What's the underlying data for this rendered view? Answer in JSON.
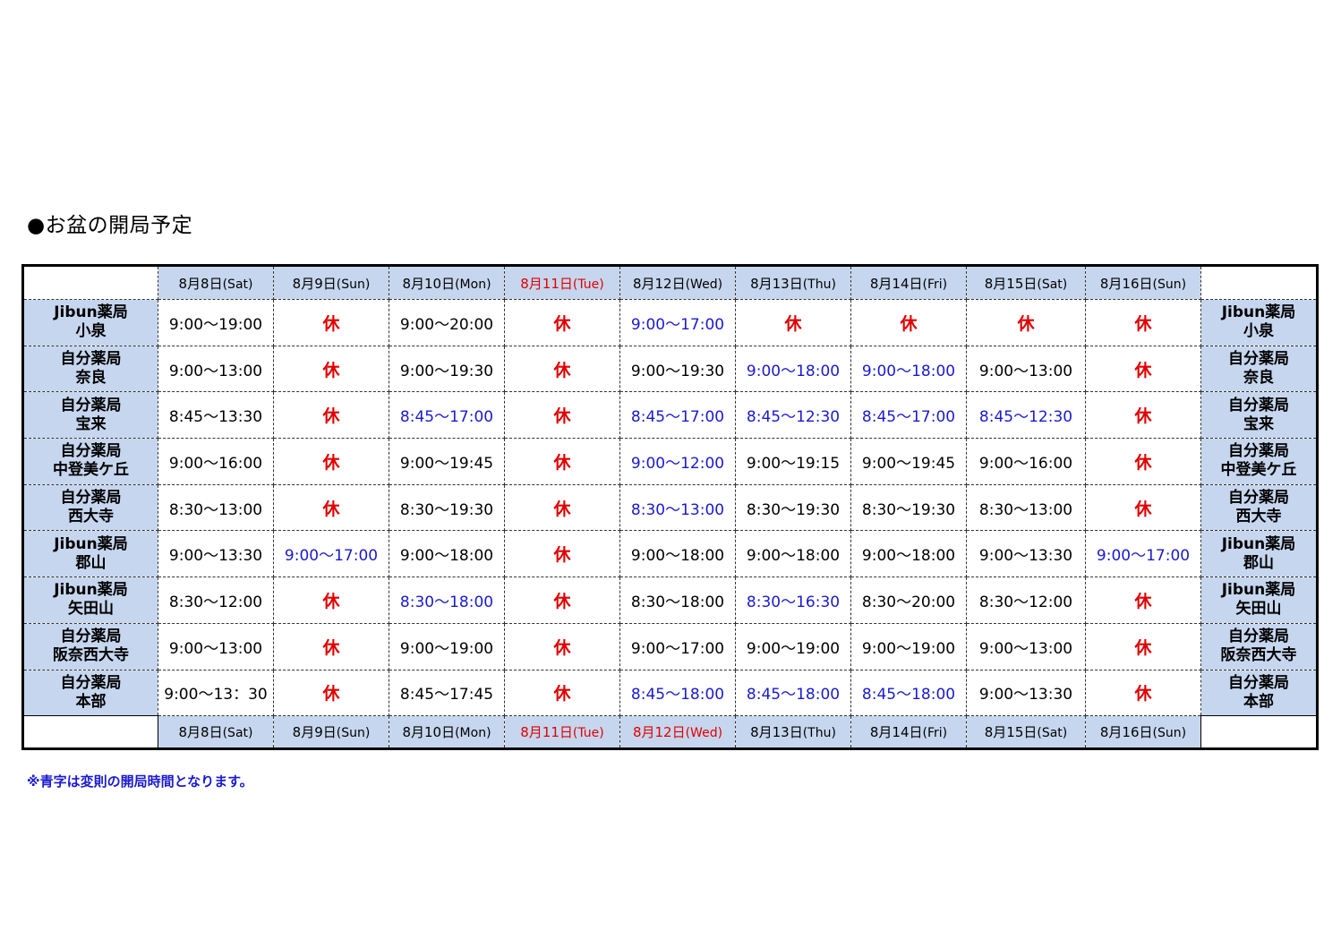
{
  "title": "●お盆の開局予定",
  "note": "※青字は変則の開局時間となります。",
  "colors": {
    "header_bg": "#c6d6ee",
    "holiday_red": "#e00000",
    "irregular_blue": "#1a1ad0"
  },
  "header_dates": [
    {
      "date": "8月8日",
      "dow": "(Sat)",
      "red": false
    },
    {
      "date": "8月9日",
      "dow": "(Sun)",
      "red": false
    },
    {
      "date": "8月10日",
      "dow": "(Mon)",
      "red": false
    },
    {
      "date": "8月11日",
      "dow": "(Tue)",
      "red": true
    },
    {
      "date": "8月12日",
      "dow": "(Wed)",
      "red": false
    },
    {
      "date": "8月13日",
      "dow": "(Thu)",
      "red": false
    },
    {
      "date": "8月14日",
      "dow": "(Fri)",
      "red": false
    },
    {
      "date": "8月15日",
      "dow": "(Sat)",
      "red": false
    },
    {
      "date": "8月16日",
      "dow": "(Sun)",
      "red": false
    }
  ],
  "footer_dates": [
    {
      "date": "8月8日",
      "dow": "(Sat)",
      "red": false
    },
    {
      "date": "8月9日",
      "dow": "(Sun)",
      "red": false
    },
    {
      "date": "8月10日",
      "dow": "(Mon)",
      "red": false
    },
    {
      "date": "8月11日",
      "dow": "(Tue)",
      "red": true
    },
    {
      "date": "8月12日",
      "dow": "(Wed)",
      "red": true
    },
    {
      "date": "8月13日",
      "dow": "(Thu)",
      "red": false
    },
    {
      "date": "8月14日",
      "dow": "(Fri)",
      "red": false
    },
    {
      "date": "8月15日",
      "dow": "(Sat)",
      "red": false
    },
    {
      "date": "8月16日",
      "dow": "(Sun)",
      "red": false
    }
  ],
  "pharmacies": [
    {
      "brand": "Jibun薬局",
      "branch": "小泉",
      "hours": [
        {
          "text": "9:00〜19:00",
          "style": "normal"
        },
        {
          "text": "休",
          "style": "closed"
        },
        {
          "text": "9:00〜20:00",
          "style": "normal"
        },
        {
          "text": "休",
          "style": "closed"
        },
        {
          "text": "9:00〜17:00",
          "style": "blue"
        },
        {
          "text": "休",
          "style": "closed"
        },
        {
          "text": "休",
          "style": "closed"
        },
        {
          "text": "休",
          "style": "closed"
        },
        {
          "text": "休",
          "style": "closed"
        }
      ]
    },
    {
      "brand": "自分薬局",
      "branch": "奈良",
      "hours": [
        {
          "text": "9:00〜13:00",
          "style": "normal"
        },
        {
          "text": "休",
          "style": "closed"
        },
        {
          "text": "9:00〜19:30",
          "style": "normal"
        },
        {
          "text": "休",
          "style": "closed"
        },
        {
          "text": "9:00〜19:30",
          "style": "normal"
        },
        {
          "text": "9:00〜18:00",
          "style": "blue"
        },
        {
          "text": "9:00〜18:00",
          "style": "blue"
        },
        {
          "text": "9:00〜13:00",
          "style": "normal"
        },
        {
          "text": "休",
          "style": "closed"
        }
      ]
    },
    {
      "brand": "自分薬局",
      "branch": "宝来",
      "hours": [
        {
          "text": "8:45〜13:30",
          "style": "normal"
        },
        {
          "text": "休",
          "style": "closed"
        },
        {
          "text": "8:45〜17:00",
          "style": "blue"
        },
        {
          "text": "休",
          "style": "closed"
        },
        {
          "text": "8:45〜17:00",
          "style": "blue"
        },
        {
          "text": "8:45〜12:30",
          "style": "blue"
        },
        {
          "text": "8:45〜17:00",
          "style": "blue"
        },
        {
          "text": "8:45〜12:30",
          "style": "blue"
        },
        {
          "text": "休",
          "style": "closed"
        }
      ]
    },
    {
      "brand": "自分薬局",
      "branch": "中登美ケ丘",
      "hours": [
        {
          "text": "9:00〜16:00",
          "style": "normal"
        },
        {
          "text": "休",
          "style": "closed"
        },
        {
          "text": "9:00〜19:45",
          "style": "normal"
        },
        {
          "text": "休",
          "style": "closed"
        },
        {
          "text": "9:00〜12:00",
          "style": "blue"
        },
        {
          "text": "9:00〜19:15",
          "style": "normal"
        },
        {
          "text": "9:00〜19:45",
          "style": "normal"
        },
        {
          "text": "9:00〜16:00",
          "style": "normal"
        },
        {
          "text": "休",
          "style": "closed"
        }
      ]
    },
    {
      "brand": "自分薬局",
      "branch": "西大寺",
      "hours": [
        {
          "text": "8:30〜13:00",
          "style": "normal"
        },
        {
          "text": "休",
          "style": "closed"
        },
        {
          "text": "8:30〜19:30",
          "style": "normal"
        },
        {
          "text": "休",
          "style": "closed"
        },
        {
          "text": "8:30〜13:00",
          "style": "blue"
        },
        {
          "text": "8:30〜19:30",
          "style": "normal"
        },
        {
          "text": "8:30〜19:30",
          "style": "normal"
        },
        {
          "text": "8:30〜13:00",
          "style": "normal"
        },
        {
          "text": "休",
          "style": "closed"
        }
      ]
    },
    {
      "brand": "Jibun薬局",
      "branch": "郡山",
      "hours": [
        {
          "text": "9:00〜13:30",
          "style": "normal"
        },
        {
          "text": "9:00〜17:00",
          "style": "blue"
        },
        {
          "text": "9:00〜18:00",
          "style": "normal"
        },
        {
          "text": "休",
          "style": "closed"
        },
        {
          "text": "9:00〜18:00",
          "style": "normal"
        },
        {
          "text": "9:00〜18:00",
          "style": "normal"
        },
        {
          "text": "9:00〜18:00",
          "style": "normal"
        },
        {
          "text": "9:00〜13:30",
          "style": "normal"
        },
        {
          "text": "9:00〜17:00",
          "style": "blue"
        }
      ]
    },
    {
      "brand": "Jibun薬局",
      "branch": "矢田山",
      "hours": [
        {
          "text": "8:30〜12:00",
          "style": "normal"
        },
        {
          "text": "休",
          "style": "closed"
        },
        {
          "text": "8:30〜18:00",
          "style": "blue"
        },
        {
          "text": "休",
          "style": "closed"
        },
        {
          "text": "8:30〜18:00",
          "style": "normal"
        },
        {
          "text": "8:30〜16:30",
          "style": "blue"
        },
        {
          "text": "8:30〜20:00",
          "style": "normal"
        },
        {
          "text": "8:30〜12:00",
          "style": "normal"
        },
        {
          "text": "休",
          "style": "closed"
        }
      ]
    },
    {
      "brand": "自分薬局",
      "branch": "阪奈西大寺",
      "hours": [
        {
          "text": "9:00〜13:00",
          "style": "normal"
        },
        {
          "text": "休",
          "style": "closed"
        },
        {
          "text": "9:00〜19:00",
          "style": "normal"
        },
        {
          "text": "休",
          "style": "closed"
        },
        {
          "text": "9:00〜17:00",
          "style": "normal"
        },
        {
          "text": "9:00〜19:00",
          "style": "normal"
        },
        {
          "text": "9:00〜19:00",
          "style": "normal"
        },
        {
          "text": "9:00〜13:00",
          "style": "normal"
        },
        {
          "text": "休",
          "style": "closed"
        }
      ]
    },
    {
      "brand": "自分薬局",
      "branch": "本部",
      "hours": [
        {
          "text": "9:00〜13：30",
          "style": "normal"
        },
        {
          "text": "休",
          "style": "closed"
        },
        {
          "text": "8:45〜17:45",
          "style": "normal"
        },
        {
          "text": "休",
          "style": "closed"
        },
        {
          "text": "8:45〜18:00",
          "style": "blue"
        },
        {
          "text": "8:45〜18:00",
          "style": "blue"
        },
        {
          "text": "8:45〜18:00",
          "style": "blue"
        },
        {
          "text": "9:00〜13:30",
          "style": "normal"
        },
        {
          "text": "休",
          "style": "closed"
        }
      ]
    }
  ]
}
